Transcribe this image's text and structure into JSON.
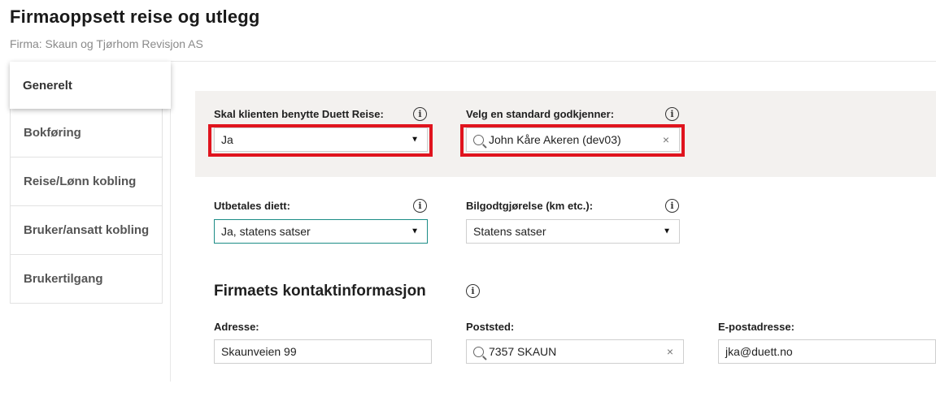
{
  "header": {
    "title": "Firmaoppsett reise og utlegg",
    "subtitle": "Firma: Skaun og Tjørhom Revisjon AS"
  },
  "sidebar": {
    "items": [
      {
        "label": "Generelt",
        "active": true
      },
      {
        "label": "Bokføring"
      },
      {
        "label": "Reise/Lønn kobling"
      },
      {
        "label": "Bruker/ansatt kobling"
      },
      {
        "label": "Brukertilgang"
      }
    ]
  },
  "settings": {
    "duett_reise": {
      "label": "Skal klienten benytte Duett Reise:",
      "value": "Ja"
    },
    "godkjenner": {
      "label": "Velg en standard godkjenner:",
      "value": "John Kåre Akeren (dev03)"
    },
    "diett": {
      "label": "Utbetales diett:",
      "value": "Ja, statens satser"
    },
    "bilgodtgjorelse": {
      "label": "Bilgodtgjørelse (km etc.):",
      "value": "Statens satser"
    }
  },
  "contact": {
    "title": "Firmaets kontaktinformasjon",
    "adresse": {
      "label": "Adresse:",
      "value": "Skaunveien 99"
    },
    "poststed": {
      "label": "Poststed:",
      "value": "7357 SKAUN"
    },
    "epost": {
      "label": "E-postadresse:",
      "value": "jka@duett.no"
    }
  },
  "icons": {
    "info": "i",
    "caret": "▼",
    "clear": "×"
  },
  "colors": {
    "highlight": "#e0141e",
    "focus_border": "#1c8c86",
    "panel_bg": "#f3f1ef"
  }
}
